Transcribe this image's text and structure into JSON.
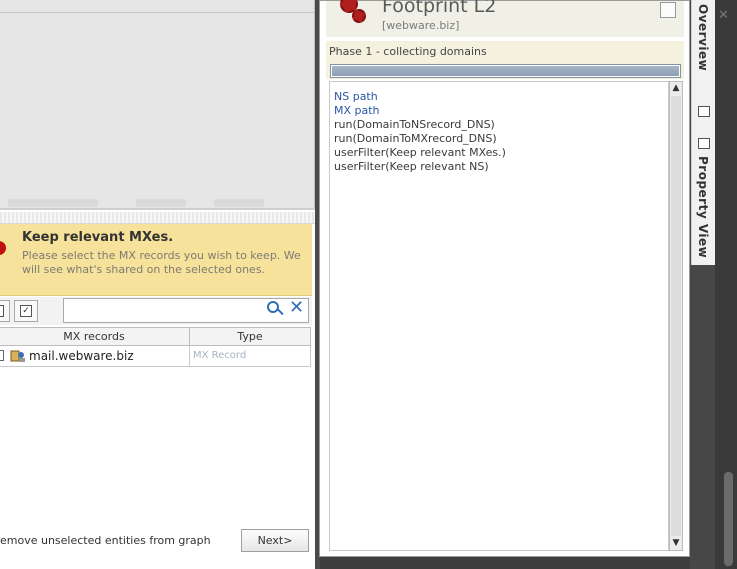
{
  "warning": {
    "title": "Keep relevant MXes.",
    "description": "Please select the MX records you wish to keep. We will see what's shared on the selected ones."
  },
  "filter": {
    "value": "",
    "placeholder": ""
  },
  "table": {
    "columns": [
      "MX records",
      "Type"
    ],
    "rows": [
      {
        "name": "mail.webware.biz",
        "type": "MX Record"
      }
    ]
  },
  "footer": {
    "option_label": "emove unselected entities from graph",
    "next_label": "Next>"
  },
  "machine_panel": {
    "title": "Footprint L2",
    "subtitle": "[webware.biz]",
    "phase": "Phase 1 - collecting domains",
    "progress": 1.0,
    "log": [
      {
        "text": "NS path",
        "link": true
      },
      {
        "text": "MX path",
        "link": true
      },
      {
        "text": "run(DomainToNSrecord_DNS)",
        "link": false
      },
      {
        "text": "run(DomainToMXrecord_DNS)",
        "link": false
      },
      {
        "text": "userFilter(Keep relevant MXes.)",
        "link": false
      },
      {
        "text": "userFilter(Keep relevant NS)",
        "link": false
      }
    ]
  },
  "side_tabs": {
    "overview": "Overview",
    "property_view": "Property View"
  },
  "icons": [
    "warning-icon",
    "checkbox-icon",
    "select-all-icon",
    "search-icon",
    "clear-icon",
    "mx-record-icon",
    "machine-gears-icon",
    "minimize-icon",
    "restore-icon",
    "property-view-icon",
    "close-icon"
  ],
  "colors": {
    "warning_bg": "#f6e29a",
    "link": "#2a57a6",
    "accent_red": "#b11e1e",
    "progress_fill": "#95a6bc"
  }
}
